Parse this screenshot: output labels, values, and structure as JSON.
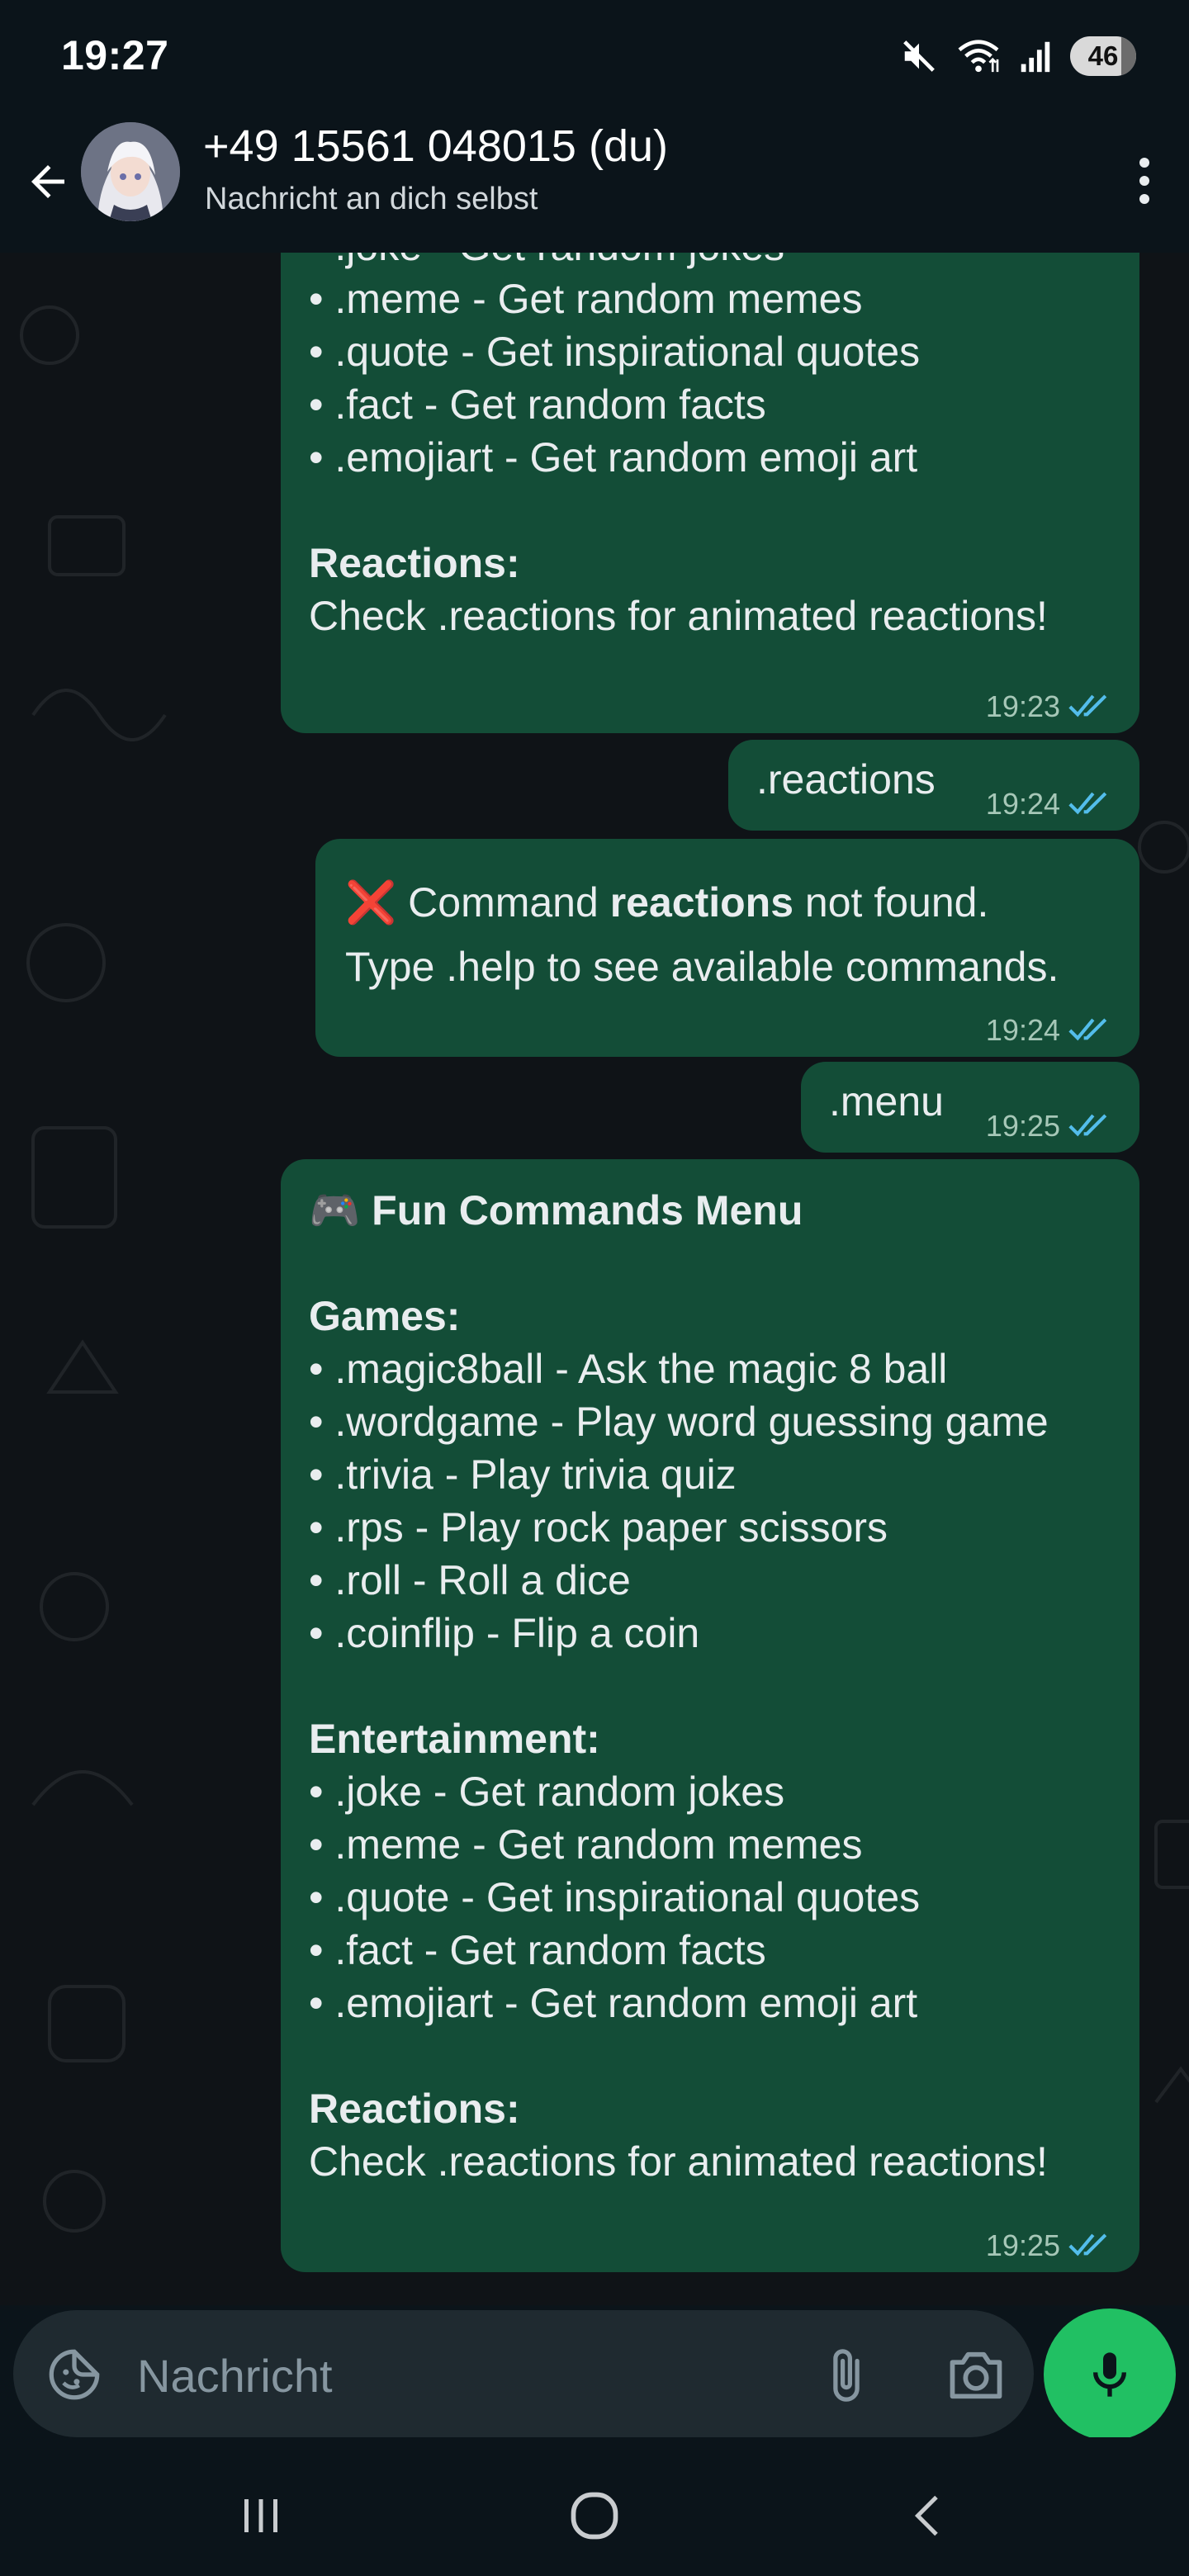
{
  "status_bar": {
    "time": "19:27",
    "battery": "46",
    "icons": [
      "mute-icon",
      "wifi-icon",
      "signal-icon",
      "battery-icon"
    ]
  },
  "header": {
    "contact_name": "+49 15561 048015 (du)",
    "subtitle": "Nachricht an dich selbst",
    "icons": [
      "back-arrow-icon",
      "avatar",
      "more-vert-icon"
    ]
  },
  "messages": [
    {
      "id": "m1",
      "lines": [
        "• .joke - Get random jokes",
        "• .meme - Get random memes",
        "• .quote - Get inspirational quotes",
        "• .fact - Get random facts",
        "• .emojiart - Get random emoji art",
        "",
        "Reactions:",
        "Check .reactions for animated reactions!"
      ],
      "time": "19:23"
    },
    {
      "id": "m2",
      "text": ".reactions",
      "time": "19:24"
    },
    {
      "id": "m3",
      "icon": "❌",
      "text_pre": " Command ",
      "text_bold": "reactions",
      "text_post": " not found.",
      "line2": "Type .help to see available commands.",
      "time": "19:24"
    },
    {
      "id": "m4",
      "text": ".menu",
      "time": "19:25"
    },
    {
      "id": "m5",
      "icon": "🎮",
      "title": "Fun Commands Menu",
      "games_heading": "Games:",
      "games": [
        "• .magic8ball - Ask the magic 8 ball",
        "• .wordgame - Play word guessing game",
        "• .trivia - Play trivia quiz",
        "• .rps - Play rock paper scissors",
        "• .roll - Roll a dice",
        "• .coinflip - Flip a coin"
      ],
      "entertainment_heading": "Entertainment:",
      "entertainment": [
        "• .joke - Get random jokes",
        "• .meme - Get random memes",
        "• .quote - Get inspirational quotes",
        "• .fact - Get random facts",
        "• .emojiart - Get random emoji art"
      ],
      "reactions_heading": "Reactions:",
      "reactions_text": "Check .reactions for animated reactions!",
      "time": "19:25"
    }
  ],
  "input": {
    "placeholder": "Nachricht",
    "value": ""
  },
  "colors": {
    "background": "#0b141a",
    "chat_background": "#0f1317",
    "outgoing_bubble": "#134d37",
    "read_ticks": "#53bdeb",
    "mic_button": "#21c063"
  }
}
